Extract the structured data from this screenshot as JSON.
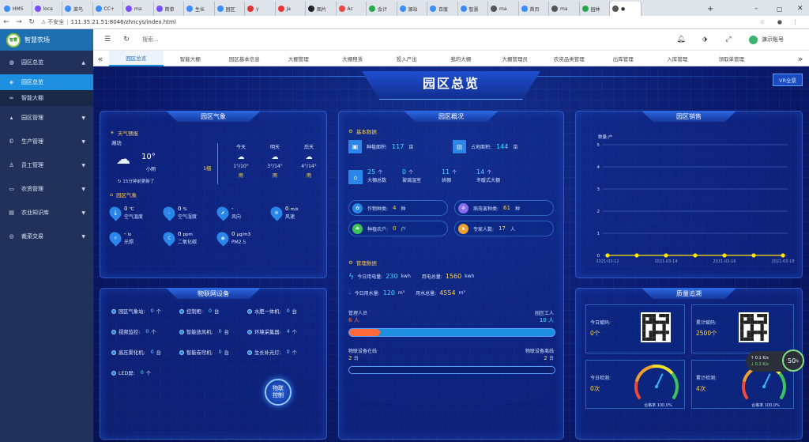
{
  "browser": {
    "tabs": [
      {
        "label": "HMS"
      },
      {
        "label": "loca"
      },
      {
        "label": "菜鸟"
      },
      {
        "label": "CC+"
      },
      {
        "label": "ma"
      },
      {
        "label": "简单"
      },
      {
        "label": "生长"
      },
      {
        "label": "园区"
      },
      {
        "label": "y"
      },
      {
        "label": "Ja"
      },
      {
        "label": "图片"
      },
      {
        "label": "Ac"
      },
      {
        "label": "会计"
      },
      {
        "label": "源站"
      },
      {
        "label": "百度"
      },
      {
        "label": "智慧"
      },
      {
        "label": "ma"
      },
      {
        "label": "首页"
      },
      {
        "label": "ma"
      },
      {
        "label": "园林"
      },
      {
        "label": "●"
      }
    ],
    "new_tab": "+",
    "insecure_label": "不安全",
    "url": "111.35.21.51:8046/zhncys/index.html"
  },
  "sidebar": {
    "brand": "智慧农场",
    "logo_text": "智慧",
    "items": [
      {
        "label": "园区总览",
        "icon": "globe-icon",
        "arrow": "▲"
      },
      {
        "label": "园区总览",
        "icon": "tag-icon",
        "selected": true
      },
      {
        "label": "智能大棚",
        "icon": "link-icon"
      },
      {
        "label": "园区管理",
        "icon": "graduate-icon",
        "arrow": "▼"
      },
      {
        "label": "生产管理",
        "icon": "copyright-icon",
        "arrow": "▼"
      },
      {
        "label": "员工管理",
        "icon": "user-icon",
        "arrow": "▼"
      },
      {
        "label": "农资管理",
        "icon": "monitor-icon",
        "arrow": "▼"
      },
      {
        "label": "农业知识库",
        "icon": "book-icon",
        "arrow": "▼"
      },
      {
        "label": "裁菜交易",
        "icon": "coin-icon",
        "arrow": "▼"
      }
    ]
  },
  "topbar": {
    "search_placeholder": "搜索...",
    "user": "演示账号"
  },
  "page_tabs": [
    "园区总览",
    "智能大棚",
    "园区基本信息",
    "大棚管理",
    "大棚租赁",
    "投入产出",
    "我的大棚",
    "大棚管理员",
    "农资品类管理",
    "出库管理",
    "入库管理",
    "领取单管理"
  ],
  "dashboard": {
    "title": "园区总览",
    "vr_button": "VR全景",
    "weather": {
      "title": "园区气象",
      "forecast_label": "天气预报",
      "city": "潍坊",
      "today_temp": "10°",
      "today_desc": "小雨",
      "wind_level": "1级",
      "updated": "15分钟前更新了",
      "days": [
        {
          "name": "今天",
          "range": "1°/10°",
          "desc": "雨"
        },
        {
          "name": "明天",
          "range": "3°/14°",
          "desc": "雨"
        },
        {
          "name": "后天",
          "range": "4°/14°",
          "desc": "雨"
        }
      ],
      "env_label": "园区气象",
      "env": [
        {
          "value": "0",
          "unit": "℃",
          "label": "空气温度"
        },
        {
          "value": "0",
          "unit": "%",
          "label": "空气湿度"
        },
        {
          "value": "-",
          "unit": "",
          "label": "风向"
        },
        {
          "value": "0",
          "unit": "m/s",
          "label": "风速"
        },
        {
          "value": "-",
          "unit": "lx",
          "label": "光照"
        },
        {
          "value": "0",
          "unit": "ppm",
          "label": "二氧化碳"
        },
        {
          "value": "0",
          "unit": "μg/m3",
          "label": "PM2.5"
        }
      ]
    },
    "overview": {
      "title": "园区概况",
      "basic_label": "基本数据",
      "planting_area": {
        "label": "种植面积:",
        "value": "117",
        "unit": "亩"
      },
      "occupied_area": {
        "label": "占地面积:",
        "value": "144",
        "unit": "亩"
      },
      "sheds": [
        {
          "value": "25",
          "unit": "个",
          "label": "大棚总数"
        },
        {
          "value": "0",
          "unit": "个",
          "label": "玻璃温室"
        },
        {
          "value": "11",
          "unit": "个",
          "label": "拱棚"
        },
        {
          "value": "14",
          "unit": "个",
          "label": "冬暖式大棚"
        }
      ],
      "stats": [
        {
          "label": "作物种类:",
          "value": "4",
          "unit": "种"
        },
        {
          "label": "病虫害种类:",
          "value": "61",
          "unit": "种"
        },
        {
          "label": "种植农户:",
          "value": "0",
          "unit": "户"
        },
        {
          "label": "专家人数:",
          "value": "17",
          "unit": "人"
        }
      ],
      "mgmt_label": "管理数据",
      "power_today": {
        "label": "今日用电量:",
        "value": "230",
        "unit": "kwh"
      },
      "power_total": {
        "label": "用电总量:",
        "value": "1560",
        "unit": "kwh"
      },
      "water_today": {
        "label": "今日用水量:",
        "value": "120",
        "unit": "m³"
      },
      "water_total": {
        "label": "用水总量:",
        "value": "4554",
        "unit": "m³"
      },
      "staff_mgr": {
        "label": "管理人员",
        "value": "6",
        "unit": "人"
      },
      "staff_worker": {
        "label": "园区工人",
        "value": "10",
        "unit": "人"
      },
      "staff_ratio": 0.15,
      "online": {
        "label": "物联设备在线",
        "value": "2",
        "unit": "台"
      },
      "offline": {
        "label": "物联设备离线",
        "value": "2",
        "unit": "台"
      }
    },
    "sales": {
      "title": "园区销售",
      "ylabel": "数量:户"
    },
    "iot": {
      "title": "物联网设备",
      "devices": [
        {
          "label": "园区气象站:",
          "value": "0",
          "unit": "个"
        },
        {
          "label": "控制柜:",
          "value": "0",
          "unit": "台"
        },
        {
          "label": "水肥一体机:",
          "value": "0",
          "unit": "台"
        },
        {
          "label": "视频监控:",
          "value": "0",
          "unit": "个"
        },
        {
          "label": "智能放风机:",
          "value": "0",
          "unit": "台"
        },
        {
          "label": "环境采集器:",
          "value": "4",
          "unit": "个"
        },
        {
          "label": "高压雾化机:",
          "value": "0",
          "unit": "台"
        },
        {
          "label": "智能卷帘机:",
          "value": "0",
          "unit": "台"
        },
        {
          "label": "生长补光灯:",
          "value": "0",
          "unit": "个"
        },
        {
          "label": "LED屏:",
          "value": "0",
          "unit": "个"
        }
      ],
      "control_button": "物联\n控制"
    },
    "trace": {
      "title": "质量追溯",
      "scan_today": {
        "label": "今日赋码:",
        "value": "0个"
      },
      "scan_total": {
        "label": "累计赋码:",
        "value": "2500个"
      },
      "check_today": {
        "label": "今日检测:",
        "value": "0次"
      },
      "check_total": {
        "label": "累计检测:",
        "value": "4次"
      },
      "pass_rate_label": "合格率 100.0%",
      "pass_rate": 1.0
    },
    "speed_widget": {
      "percent": "50",
      "up": "0.1",
      "down": "0.1",
      "unit": "K/s"
    }
  },
  "chart_data": {
    "type": "line",
    "title": "",
    "xlabel": "",
    "ylabel": "数量:户",
    "x": [
      "2021-03-12",
      "2021-03-13",
      "2021-03-14",
      "2021-03-15",
      "2021-03-16",
      "2021-03-17",
      "2021-03-18"
    ],
    "x_tick_labels": [
      "2021-03-12",
      "2021-03-14",
      "2021-03-16",
      "2021-03-18"
    ],
    "series": [
      {
        "values": [
          0,
          0,
          0,
          0,
          0,
          0,
          0
        ]
      }
    ],
    "ylim": [
      0,
      5
    ],
    "yticks": [
      0,
      1,
      2,
      3,
      4,
      5
    ],
    "grid": true,
    "line_color": "#ffe600"
  }
}
